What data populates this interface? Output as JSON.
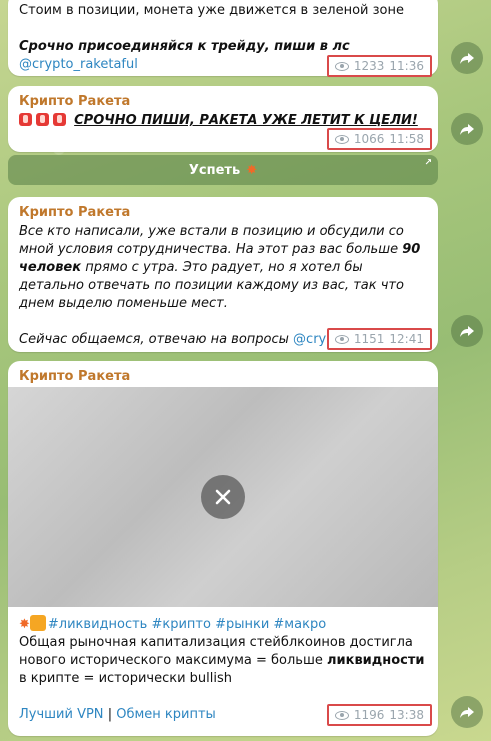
{
  "messages": [
    {
      "id": "m1",
      "lines": [
        "Стоим в позиции, монета уже движется в зеленой зоне",
        "Срочно присоединяйся к трейду, пиши в лс "
      ],
      "mention": "@crypto_raketaful",
      "views": "1233",
      "time": "11:36"
    },
    {
      "id": "m2",
      "author": "Крипто Ракета",
      "text": "СРОЧНО ПИШИ, РАКЕТА УЖЕ ЛЕТИТ К ЦЕЛИ!",
      "views": "1066",
      "time": "11:58",
      "button": "Успеть"
    },
    {
      "id": "m3",
      "author": "Крипто Ракета",
      "paragraph_1a": "Все кто написали, уже встали в позицию и обсудили со мной условия сотрудничества. На этот раз вас больше ",
      "paragraph_1_bold": "90 человек",
      "paragraph_1b": " прямо с утра. Это радует, но я хотел бы детально отвечать по позиции каждому из вас, так что днем выделю поменьше мест.",
      "paragraph_2": "Сейчас общаемся, отвечаю на вопросы ",
      "mention": "@crypto_raketaful",
      "views": "1151",
      "time": "12:41"
    },
    {
      "id": "m4",
      "author": "Крипто Ракета",
      "hashtags": "#ликвидность #крипто #рынки #макро",
      "body_a": "Общая рыночная капитализация стейблкоинов достигла нового исторического максимума = больше ",
      "body_bold": "ликвидности",
      "body_b": " в крипте = исторически bullish",
      "link_1": "Лучший VPN",
      "separator": "|",
      "link_2": "Обмен крипты",
      "views": "1196",
      "time": "13:38"
    }
  ],
  "colors": {
    "author": "#c0782c",
    "link": "#2e86c1",
    "highlight_border": "#d94a4a"
  },
  "icons": {
    "share": "share-forward-icon",
    "views": "eye-icon",
    "media_close": "close-icon"
  }
}
